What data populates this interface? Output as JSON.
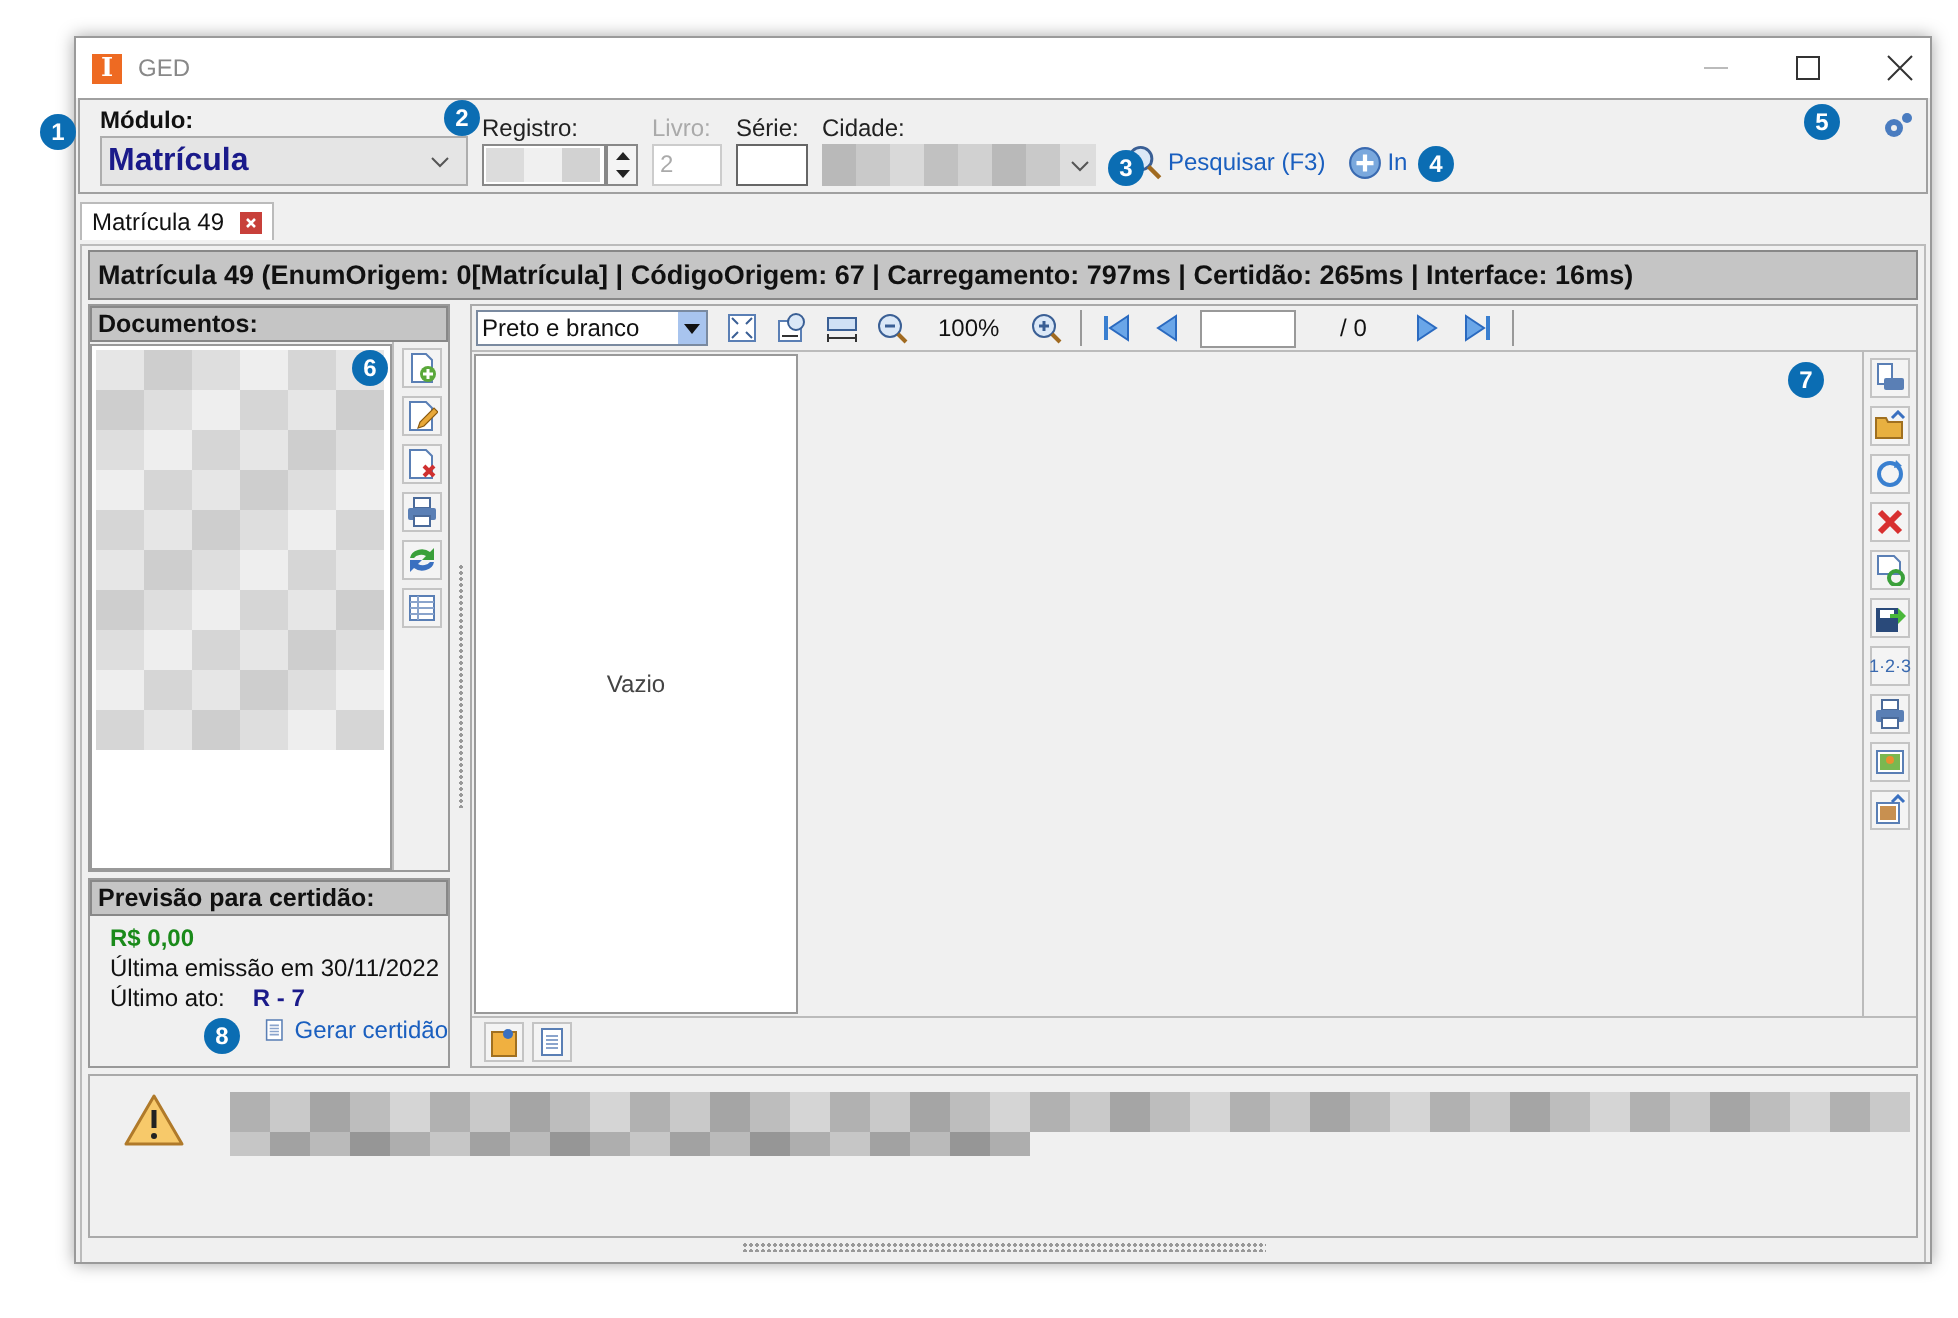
{
  "window": {
    "title": "GED",
    "logo": "I"
  },
  "toolbar": {
    "module_label": "Módulo:",
    "module_value": "Matrícula",
    "registro_label": "Registro:",
    "livro_label": "Livro:",
    "livro_value": "2",
    "livro_disabled": true,
    "serie_label": "Série:",
    "cidade_label": "Cidade:",
    "search_link": "Pesquisar (F3)",
    "add_link": "In"
  },
  "tabs": [
    {
      "label": "Matrícula 49",
      "selected": true
    }
  ],
  "info_bar": "Matrícula 49 (EnumOrigem: 0[Matrícula] | CódigoOrigem: 67 | Carregamento: 797ms | Certidão: 265ms | Interface: 16ms)",
  "documents": {
    "title": "Documentos:"
  },
  "forecast": {
    "title": "Previsão para certidão:",
    "amount": "R$ 0,00",
    "last_emission": "Última emissão em 30/11/2022",
    "last_act_label": "Último ato:",
    "last_act_value": "R - 7",
    "generate_link": "Gerar certidão"
  },
  "viewer": {
    "color_mode": "Preto e branco",
    "zoom": "100%",
    "page_total": "/ 0",
    "empty_text": "Vazio",
    "numbering_button": "1·2·3"
  },
  "callouts": [
    {
      "number": "1"
    },
    {
      "number": "2"
    },
    {
      "number": "3"
    },
    {
      "number": "4"
    },
    {
      "number": "5"
    },
    {
      "number": "6"
    },
    {
      "number": "7"
    },
    {
      "number": "8"
    }
  ]
}
